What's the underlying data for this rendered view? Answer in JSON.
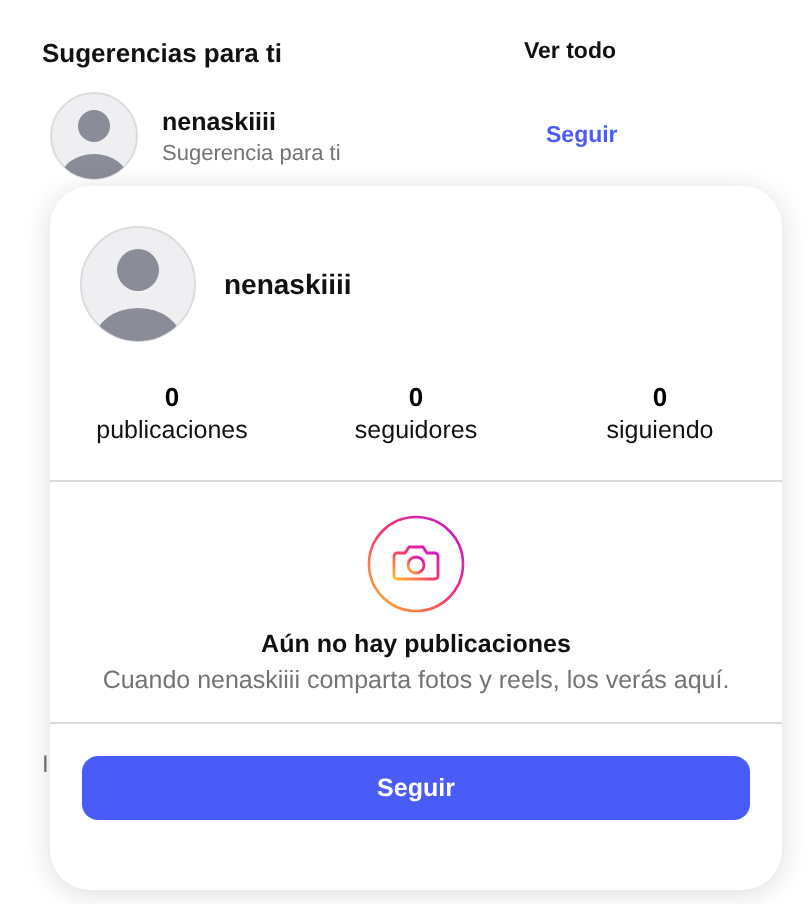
{
  "suggestions": {
    "title": "Sugerencias para ti",
    "see_all": "Ver todo",
    "items": [
      {
        "username": "nenaskiiii",
        "subtitle": "Sugerencia para ti",
        "action": "Seguir"
      }
    ]
  },
  "footer_fragments": [
    "I"
  ],
  "profile_card": {
    "username": "nenaskiiii",
    "stats": [
      {
        "value": "0",
        "label": "publicaciones"
      },
      {
        "value": "0",
        "label": "seguidores"
      },
      {
        "value": "0",
        "label": "siguiendo"
      }
    ],
    "empty_title": "Aún no hay publicaciones",
    "empty_text": "Cuando nenaskiiii comparta fotos y reels, los verás aquí.",
    "follow_button": "Seguir"
  }
}
